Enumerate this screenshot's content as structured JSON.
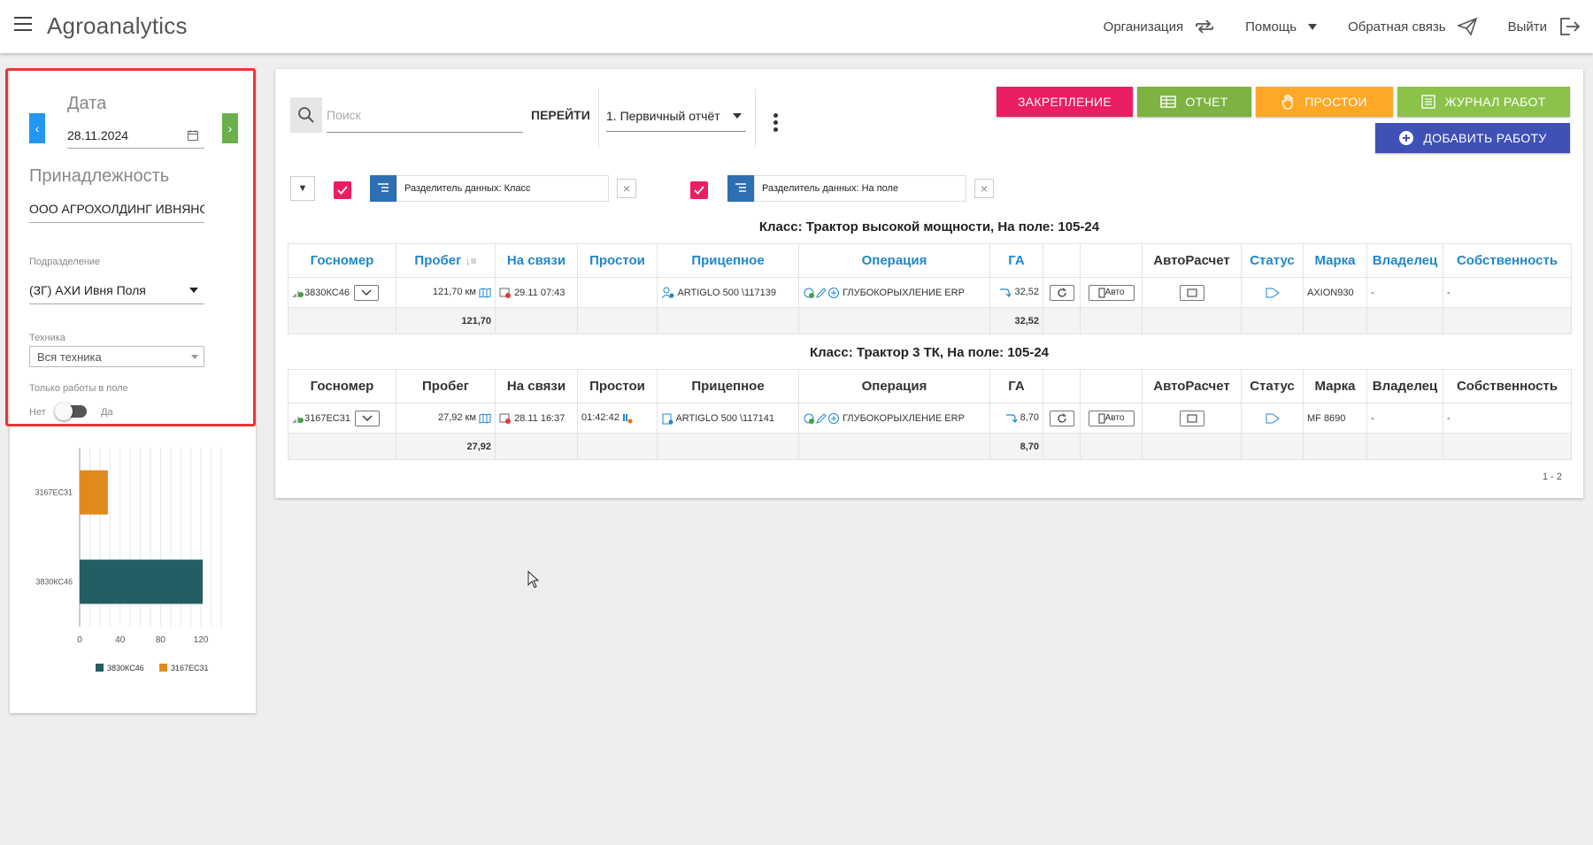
{
  "header": {
    "app_title": "Agroanalytics",
    "nav": [
      {
        "label": "Организация",
        "icon": "switch-arrows-icon"
      },
      {
        "label": "Помощь",
        "icon": "caret-down-icon"
      },
      {
        "label": "Обратная связь",
        "icon": "paper-plane-icon"
      },
      {
        "label": "Выйти",
        "icon": "logout-icon"
      }
    ]
  },
  "filters": {
    "date_label": "Дата",
    "date_value": "28.11.2024",
    "ownership_label": "Принадлежность",
    "ownership_value": "ООО АГРОХОЛДИНГ ИВНЯНСКИЙ",
    "subdivision_label": "Подразделение",
    "subdivision_value": "(ЗГ) АХИ Ивня Поля",
    "machinery_label": "Техника",
    "machinery_value": "Вся техника",
    "field_only_label": "Только работы в поле",
    "toggle_off": "Нет",
    "toggle_on": "Да"
  },
  "toolbar": {
    "search_placeholder": "Поиск",
    "goto_label": "ПЕРЕЙТИ",
    "report_value": "1. Первичный отчёт",
    "buttons": {
      "assign": "ЗАКРЕПЛЕНИЕ",
      "report": "ОТЧЕТ",
      "idle": "ПРОСТОИ",
      "journal": "ЖУРНАЛ РАБОТ",
      "add_work": "ДОБАВИТЬ РАБОТУ"
    },
    "colors": {
      "assign": "#e91e63",
      "report": "#7cb342",
      "idle": "#ffa726",
      "journal": "#8bc34a",
      "add_work": "#3f51b5"
    }
  },
  "chips": [
    {
      "label": "Разделитель данных: Класс"
    },
    {
      "label": "Разделитель данных: На поле"
    }
  ],
  "groups": [
    {
      "title": "Класс: Трактор высокой мощности, На поле: 105-24",
      "columns": [
        "Госномер",
        "Пробег",
        "На связи",
        "Простои",
        "Прицепное",
        "Операция",
        "ГА",
        "",
        "",
        "АвтоРасчет",
        "Статус",
        "Марка",
        "Владелец",
        "Собственность"
      ],
      "row": {
        "plate": "3830КС46",
        "mileage": "121,70 км",
        "online": "29.11 07:43",
        "idle": "",
        "trailer": "ARTIGLO 500 \\117139",
        "operation": "ГЛУБОКОРЫХЛЕНИЕ ERP",
        "ha": "32,52",
        "auto_label": "Авто",
        "brand": "AXION930",
        "owner": "-",
        "property": "-"
      },
      "total": {
        "mileage": "121,70",
        "ha": "32,52"
      }
    },
    {
      "title": "Класс: Трактор 3 ТК, На поле: 105-24",
      "columns": [
        "Госномер",
        "Пробег",
        "На связи",
        "Простои",
        "Прицепное",
        "Операция",
        "ГА",
        "",
        "",
        "АвтоРасчет",
        "Статус",
        "Марка",
        "Владелец",
        "Собственность"
      ],
      "row": {
        "plate": "3167ЕС31",
        "mileage": "27,92 км",
        "online": "28.11 16:37",
        "idle": "01:42:42",
        "trailer": "ARTIGLO 500 \\117141",
        "operation": "ГЛУБОКОРЫХЛЕНИЕ ERP",
        "ha": "8,70",
        "auto_label": "Авто",
        "brand": "MF 8690",
        "owner": "-",
        "property": "-"
      },
      "total": {
        "mileage": "27,92",
        "ha": "8,70"
      }
    }
  ],
  "pager": "1 - 2",
  "chart_data": {
    "type": "bar",
    "orientation": "horizontal",
    "categories": [
      "3167ЕС31",
      "3830КС46"
    ],
    "values": [
      27.92,
      121.7
    ],
    "colors": [
      "#e08a1e",
      "#235e63"
    ],
    "xticks": [
      0,
      40,
      80,
      120
    ],
    "xlim": [
      0,
      140
    ],
    "legend": [
      "3830КС46",
      "3167ЕС31"
    ],
    "legend_colors": [
      "#235e63",
      "#e08a1e"
    ],
    "legend_position": "bottom"
  }
}
